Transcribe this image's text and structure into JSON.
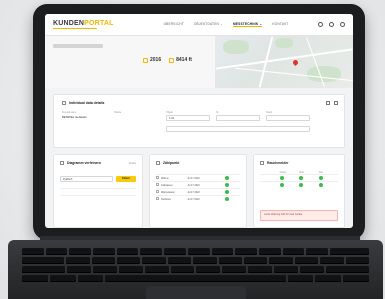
{
  "brand": {
    "main": "KUNDEN",
    "accent": "PORTAL"
  },
  "nav": {
    "items": [
      "ÜBERSICHT",
      "OBJEKTDATEN ⌄",
      "MESSTECHNIK ⌄",
      "KONTAKT"
    ],
    "active_index": 2
  },
  "stats": {
    "year": "2016",
    "area": "8414 ft"
  },
  "detail": {
    "title": "Individual data details",
    "fields": [
      {
        "label": "Kundenname",
        "value": "BEISPIEL Gebäude"
      },
      {
        "label": "Straße",
        "value": ""
      },
      {
        "label": "Objekt",
        "value": "1.02"
      },
      {
        "label": "Nr.",
        "value": ""
      },
      {
        "label": "Stand",
        "value": ""
      }
    ]
  },
  "card1": {
    "title": "Diagramm verfeinern",
    "hint": "Details",
    "select_value": "Zyklisch",
    "button": "Filtern"
  },
  "card2": {
    "title": "Zählpunkt",
    "rows": [
      {
        "name": "Wärme",
        "date": "Jul 17 2022"
      },
      {
        "name": "Kaltwasser",
        "date": "Jul 17 2022"
      },
      {
        "name": "Warmwasser",
        "date": "Jul 17 2022"
      },
      {
        "name": "Heizkreis",
        "date": "Jul 17 2022"
      }
    ]
  },
  "card3": {
    "title": "Rauchmelder",
    "cols": [
      "Status",
      "Aktiv",
      "Test"
    ],
    "alert": "Letzte Wartung fehlt für zwei Geräte"
  },
  "colors": {
    "accent": "#f2b705",
    "ok": "#3dbb4f",
    "alert": "#e3342f"
  }
}
